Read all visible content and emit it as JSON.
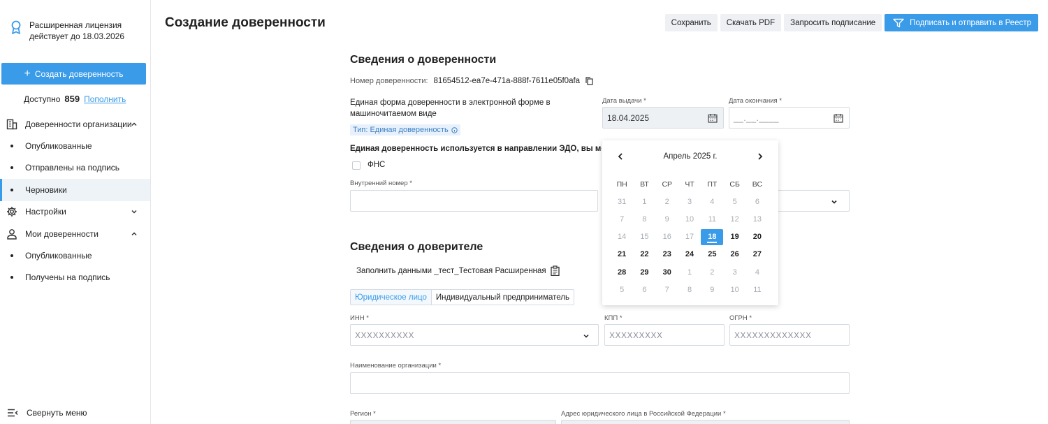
{
  "sidebar": {
    "license_line1": "Расширенная лицензия",
    "license_line2": "действует до 18.03.2026",
    "create_button": "Создать доверенность",
    "balance_label": "Доступно",
    "balance_value": "859",
    "balance_link": "Пополнить",
    "items": [
      {
        "label": "Доверенности организации",
        "icon": "building-icon",
        "chevron": "up"
      },
      {
        "label": "Опубликованные",
        "sub": true
      },
      {
        "label": "Отправлены на подпись",
        "sub": true
      },
      {
        "label": "Черновики",
        "sub": true,
        "active": true
      },
      {
        "label": "Настройки",
        "icon": "gear-icon",
        "chevron": "down"
      },
      {
        "label": "Мои доверенности",
        "icon": "user-icon",
        "chevron": "up"
      },
      {
        "label": "Опубликованные",
        "sub": true
      },
      {
        "label": "Получены на подпись",
        "sub": true
      }
    ],
    "collapse_label": "Свернуть меню"
  },
  "header": {
    "title": "Создание доверенности",
    "buttons": {
      "save": "Сохранить",
      "download_pdf": "Скачать PDF",
      "request_sign": "Запросить подписание",
      "sign_send": "Подписать и отправить в Реестр"
    }
  },
  "poa": {
    "section_title": "Сведения о доверенности",
    "number_label": "Номер доверенности:",
    "number_value": "81654512-ea7e-471a-888f-7611e05f0afa",
    "form_desc_line1": "Единая форма доверенности в электронной форме в",
    "form_desc_line2": "машиночитаемом виде",
    "type_badge": "Тип: Единая доверенность",
    "issue_date_label": "Дата выдачи *",
    "issue_date_value": "18.04.2025",
    "end_date_label": "Дата окончания *",
    "end_date_placeholder": "__.__.____",
    "edo_text": "Единая доверенность используется в направлении ЭДО, вы можете",
    "fns_label": "ФНС",
    "internal_number_label": "Внутренний номер *"
  },
  "calendar": {
    "month": "Апрель 2025 г.",
    "weekdays": [
      "ПН",
      "ВТ",
      "СР",
      "ЧТ",
      "ПТ",
      "СБ",
      "ВС"
    ],
    "weeks": [
      [
        {
          "d": "31",
          "s": "muted"
        },
        {
          "d": "1",
          "s": "muted"
        },
        {
          "d": "2",
          "s": "muted"
        },
        {
          "d": "3",
          "s": "muted"
        },
        {
          "d": "4",
          "s": "muted"
        },
        {
          "d": "5",
          "s": "muted"
        },
        {
          "d": "6",
          "s": "muted"
        }
      ],
      [
        {
          "d": "7",
          "s": "muted"
        },
        {
          "d": "8",
          "s": "muted"
        },
        {
          "d": "9",
          "s": "muted"
        },
        {
          "d": "10",
          "s": "muted"
        },
        {
          "d": "11",
          "s": "muted"
        },
        {
          "d": "12",
          "s": "muted"
        },
        {
          "d": "13",
          "s": "muted"
        }
      ],
      [
        {
          "d": "14",
          "s": "muted"
        },
        {
          "d": "15",
          "s": "muted"
        },
        {
          "d": "16",
          "s": "muted"
        },
        {
          "d": "17",
          "s": "muted"
        },
        {
          "d": "18",
          "s": "sel"
        },
        {
          "d": "19",
          "s": "cur"
        },
        {
          "d": "20",
          "s": "cur"
        }
      ],
      [
        {
          "d": "21",
          "s": "cur"
        },
        {
          "d": "22",
          "s": "cur"
        },
        {
          "d": "23",
          "s": "cur"
        },
        {
          "d": "24",
          "s": "cur"
        },
        {
          "d": "25",
          "s": "cur"
        },
        {
          "d": "26",
          "s": "cur"
        },
        {
          "d": "27",
          "s": "cur"
        }
      ],
      [
        {
          "d": "28",
          "s": "cur"
        },
        {
          "d": "29",
          "s": "cur"
        },
        {
          "d": "30",
          "s": "cur"
        },
        {
          "d": "1",
          "s": "muted"
        },
        {
          "d": "2",
          "s": "muted"
        },
        {
          "d": "3",
          "s": "muted"
        },
        {
          "d": "4",
          "s": "muted"
        }
      ],
      [
        {
          "d": "5",
          "s": "muted"
        },
        {
          "d": "6",
          "s": "muted"
        },
        {
          "d": "7",
          "s": "muted"
        },
        {
          "d": "8",
          "s": "muted"
        },
        {
          "d": "9",
          "s": "muted"
        },
        {
          "d": "10",
          "s": "muted"
        },
        {
          "d": "11",
          "s": "muted"
        }
      ]
    ]
  },
  "principal": {
    "section_title": "Сведения о доверителе",
    "fill_with_data": "Заполнить данными _тест_Тестовая Расширенная",
    "tabs": [
      "Юридическое лицо",
      "Индивидуальный предприниматель"
    ],
    "inn_label": "ИНН *",
    "inn_placeholder": "XXXXXXXXXX",
    "kpp_label": "КПП *",
    "kpp_placeholder": "XXXXXXXXX",
    "ogrn_label": "ОГРН *",
    "ogrn_placeholder": "XXXXXXXXXXXXX",
    "org_name_label": "Наименование организации *",
    "region_label": "Регион *",
    "address_label": "Адрес юридического лица в Российской Федерации *"
  },
  "colors": {
    "accent": "#3a9be9",
    "sidebar_active": "#eef3f8"
  }
}
